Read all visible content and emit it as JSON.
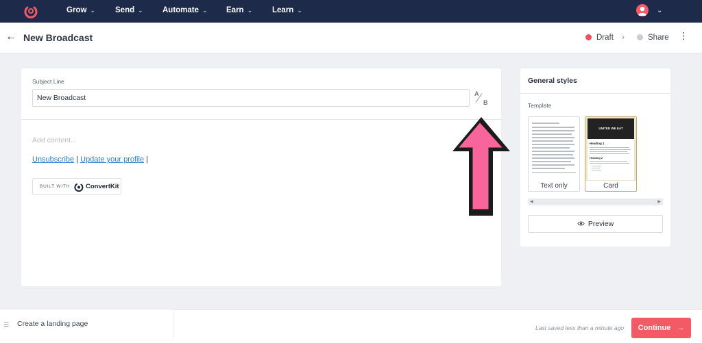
{
  "colors": {
    "nav_bg": "#1e2a4a",
    "accent": "#f25b66",
    "draft_dot": "#f0505c",
    "share_dot": "#c9ccd2",
    "arrow_pink": "#f7659a",
    "link": "#2d7dd2"
  },
  "nav": {
    "logo_icon": "convertkit-logo-icon",
    "items": [
      {
        "label": "Grow"
      },
      {
        "label": "Send"
      },
      {
        "label": "Automate"
      },
      {
        "label": "Earn"
      },
      {
        "label": "Learn"
      }
    ],
    "avatar_icon": "user-avatar"
  },
  "header": {
    "title": "New Broadcast",
    "status_draft": "Draft",
    "status_share": "Share"
  },
  "editor": {
    "subject_label": "Subject Line",
    "subject_value": "New Broadcast",
    "ab_a": "A",
    "ab_b": "B",
    "content_placeholder": "Add content...",
    "unsubscribe_link": "Unsubscribe",
    "separator": "|",
    "update_profile_link": "Update your profile",
    "built_with": "BUILT WITH",
    "brand": "ConvertKit"
  },
  "panel": {
    "title": "General styles",
    "template_label": "Template",
    "templates": [
      {
        "label": "Text only"
      },
      {
        "label": "Card",
        "thumb_banner": "UNITED WE EAT",
        "thumb_heading1": "Heading 1",
        "thumb_heading2": "Heading 2"
      }
    ],
    "preview_label": "Preview"
  },
  "footer": {
    "landing_label": "Create a landing page",
    "saved_text": "Last saved less than a minute ago",
    "continue_label": "Continue",
    "continue_arrow": "→"
  }
}
